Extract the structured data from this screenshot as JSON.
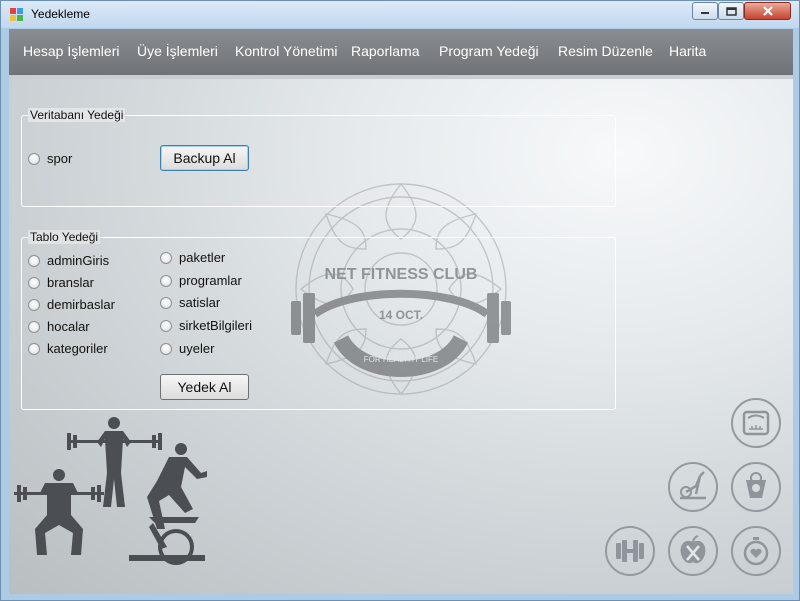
{
  "window": {
    "title": "Yedekleme"
  },
  "menu": {
    "items": [
      "Hesap İşlemleri",
      "Üye İşlemleri",
      "Kontrol Yönetimi",
      "Raporlama",
      "Program Yedeği",
      "Resim Düzenle",
      "Harita"
    ]
  },
  "database_backup": {
    "label": "Veritabanı Yedeği",
    "database_option": "spor",
    "button": "Backup Al"
  },
  "table_backup": {
    "label": "Tablo Yedeği",
    "left_options": [
      "adminGiris",
      "branslar",
      "demirbaslar",
      "hocalar",
      "kategoriler"
    ],
    "right_options": [
      "paketler",
      "programlar",
      "satislar",
      "sirketBilgileri",
      "uyeler"
    ],
    "button": "Yedek Al"
  },
  "watermark": {
    "title": "NET FITNESS CLUB",
    "date": "14 OCT.",
    "tagline": "FOR HEALTHY LIFE"
  },
  "icons": [
    "scale-icon",
    "exercise-bike-icon",
    "weight-icon",
    "dumbbell-icon",
    "apple-fork-knife-icon",
    "stopwatch-heart-icon"
  ],
  "colors": {
    "menubar": "#7c8084",
    "titlebar": "#c8dcf0",
    "close_button": "#c7432b"
  }
}
